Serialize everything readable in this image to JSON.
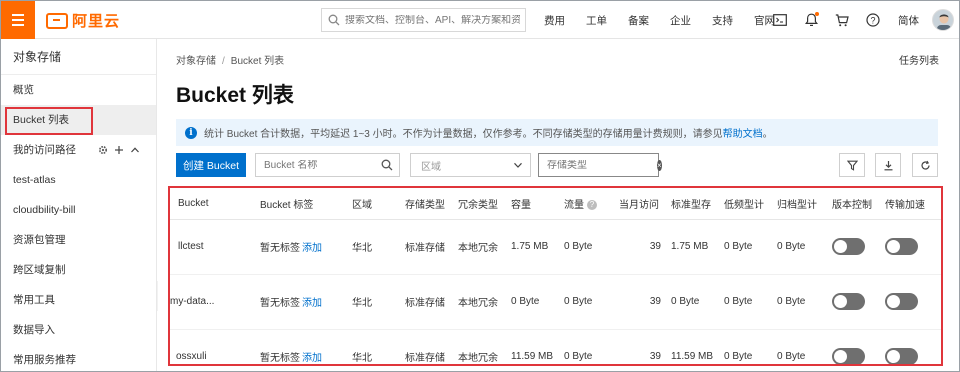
{
  "topbar": {
    "brand": "阿里云",
    "search_placeholder": "搜索文档、控制台、API、解决方案和资源",
    "nav": [
      "费用",
      "工单",
      "备案",
      "企业",
      "支持",
      "官网"
    ],
    "language": "简体",
    "icons": [
      "menu-icon",
      "terminal-icon",
      "bell-icon",
      "cart-icon",
      "help-icon"
    ],
    "accent_color": "#ff6a00"
  },
  "sidebar": {
    "title": "对象存储",
    "items": [
      {
        "label": "概览"
      },
      {
        "label": "Bucket 列表"
      },
      {
        "label": "我的访问路径"
      },
      {
        "label": "test-atlas"
      },
      {
        "label": "cloudbility-bill"
      },
      {
        "label": "资源包管理"
      },
      {
        "label": "跨区域复制"
      },
      {
        "label": "常用工具"
      },
      {
        "label": "数据导入"
      },
      {
        "label": "常用服务推荐"
      }
    ]
  },
  "main": {
    "breadcrumb": [
      "对象存储",
      "Bucket 列表"
    ],
    "task_list": "任务列表",
    "title": "Bucket 列表",
    "notice": {
      "text": "统计 Bucket 合计数据，平均延迟 1~3 小时。不作为计量数据，仅作参考。不同存储类型的存储用量计费规则，请参见",
      "link": "帮助文档",
      "suffix": "。"
    },
    "toolbar": {
      "create_label": "创建 Bucket",
      "search_placeholder": "Bucket 名称",
      "region_placeholder": "区域",
      "type_value": "存储类型"
    },
    "table": {
      "headers": [
        "Bucket",
        "Bucket 标签",
        "区域",
        "存储类型",
        "冗余类型",
        "容量",
        "流量",
        "当月访问",
        "标准型存",
        "低频型计",
        "归档型计",
        "版本控制",
        "传输加速"
      ],
      "tag_empty": "暂无标签",
      "tag_add": "添加",
      "rows": [
        {
          "name": "llctest",
          "region": "华北",
          "storage": "标准存储",
          "redundancy": "本地冗余",
          "capacity": "1.75 MB",
          "traffic": "0 Byte",
          "visits": "39",
          "standard": "1.75 MB",
          "ia": "0 Byte",
          "archive": "0 Byte"
        },
        {
          "name": "my-data...",
          "region": "华北",
          "storage": "标准存储",
          "redundancy": "本地冗余",
          "capacity": "0 Byte",
          "traffic": "0 Byte",
          "visits": "39",
          "standard": "0 Byte",
          "ia": "0 Byte",
          "archive": "0 Byte"
        },
        {
          "name": "ossxuli",
          "region": "华北",
          "storage": "标准存储",
          "redundancy": "本地冗余",
          "capacity": "11.59 MB",
          "traffic": "0 Byte",
          "visits": "39",
          "standard": "11.59 MB",
          "ia": "0 Byte",
          "archive": "0 Byte"
        }
      ]
    }
  }
}
